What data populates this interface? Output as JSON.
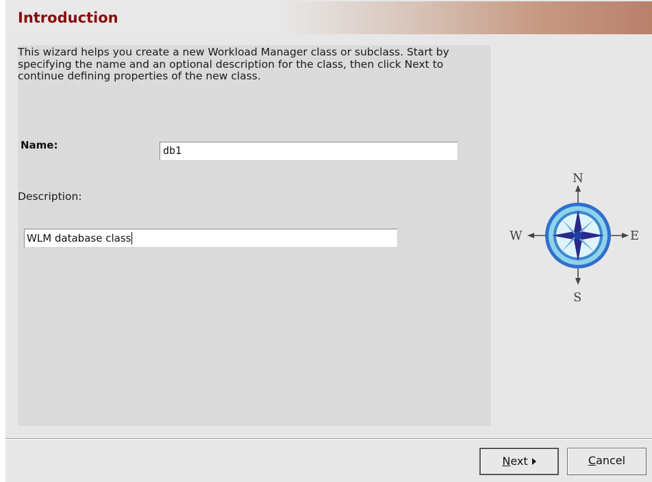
{
  "header": {
    "title": "Introduction"
  },
  "intro": {
    "text": "This wizard helps you create a new Workload Manager class or subclass. Start by specifying the name and an optional description for the class, then click Next to continue defining properties of the new class."
  },
  "form": {
    "name_label": "Name:",
    "name_value": "db1",
    "description_label": "Description:",
    "description_value": "WLM database class"
  },
  "compass": {
    "north": "N",
    "south": "S",
    "east": "E",
    "west": "W"
  },
  "buttons": {
    "next_first": "N",
    "next_rest": "ext",
    "cancel_first": "C",
    "cancel_rest": "ancel"
  },
  "colors": {
    "title": "#8a0c0c",
    "compass_blue": "#2f6fcf"
  }
}
